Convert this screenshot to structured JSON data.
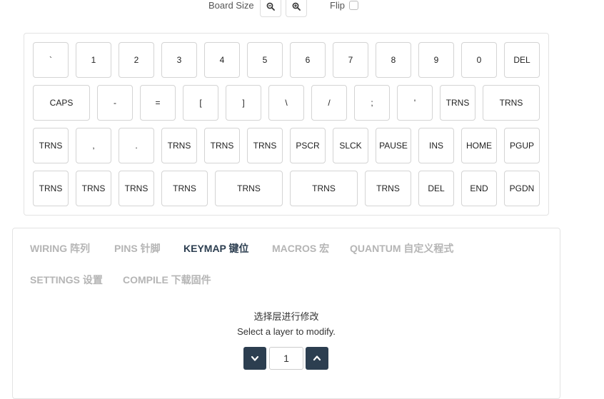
{
  "toolbar": {
    "board_size_label": "Board Size",
    "flip_label": "Flip",
    "zoom_out_icon": "zoom-out-icon",
    "zoom_in_icon": "zoom-in-icon"
  },
  "keyboard": {
    "rows": [
      [
        "`",
        "1",
        "2",
        "3",
        "4",
        "5",
        "6",
        "7",
        "8",
        "9",
        "0",
        "DEL"
      ],
      [
        "CAPS",
        "-",
        "=",
        "[",
        "]",
        "\\",
        "/",
        ";",
        "'",
        "TRNS",
        "TRNS"
      ],
      [
        "TRNS",
        ",",
        ".",
        "TRNS",
        "TRNS",
        "TRNS",
        "PSCR",
        "SLCK",
        "PAUSE",
        "INS",
        "HOME",
        "PGUP"
      ],
      [
        "TRNS",
        "TRNS",
        "TRNS",
        "TRNS",
        "TRNS",
        "TRNS",
        "TRNS",
        "DEL",
        "END",
        "PGDN"
      ]
    ]
  },
  "tabs": [
    {
      "label": "WIRING 阵列",
      "active": false
    },
    {
      "label": "PINS 针脚",
      "active": false
    },
    {
      "label": "KEYMAP 键位",
      "active": true
    },
    {
      "label": "MACROS 宏",
      "active": false
    },
    {
      "label": "QUANTUM 自定义程式",
      "active": false
    },
    {
      "label": "SETTINGS 设置",
      "active": false
    },
    {
      "label": "COMPILE 下载固件",
      "active": false
    }
  ],
  "layer": {
    "prompt_cn": "选择层进行修改",
    "prompt_en": "Select a layer to modify.",
    "value": "1",
    "colors": {
      "button_bg": "#2c3e50",
      "active_tab": "#2c3e50",
      "inactive_tab": "#b5b5b5"
    }
  }
}
